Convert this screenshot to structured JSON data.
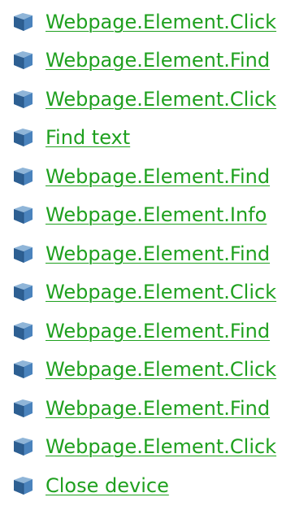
{
  "icon": "cube-icon",
  "colors": {
    "link": "#1fa01f",
    "icon_top": "#8fb5d8",
    "icon_left": "#2d5f92",
    "icon_right": "#4a83bd"
  },
  "items": [
    {
      "label": "Webpage.Element.Click"
    },
    {
      "label": "Webpage.Element.Find"
    },
    {
      "label": "Webpage.Element.Click"
    },
    {
      "label": "Find text"
    },
    {
      "label": "Webpage.Element.Find"
    },
    {
      "label": "Webpage.Element.Info"
    },
    {
      "label": "Webpage.Element.Find"
    },
    {
      "label": "Webpage.Element.Click"
    },
    {
      "label": "Webpage.Element.Find"
    },
    {
      "label": "Webpage.Element.Click"
    },
    {
      "label": "Webpage.Element.Find"
    },
    {
      "label": "Webpage.Element.Click"
    },
    {
      "label": "Close device"
    }
  ]
}
